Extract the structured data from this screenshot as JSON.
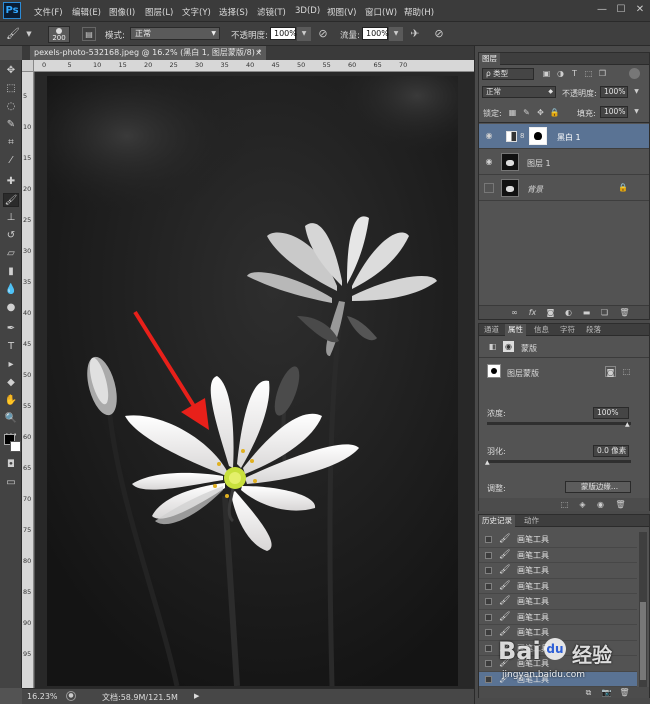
{
  "app": {
    "logo": "Ps"
  },
  "menubar": {
    "items": [
      "文件(F)",
      "编辑(E)",
      "图像(I)",
      "图层(L)",
      "文字(Y)",
      "选择(S)",
      "滤镜(T)",
      "3D(D)",
      "视图(V)",
      "窗口(W)",
      "帮助(H)"
    ],
    "window_buttons": {
      "minimize": "—",
      "maximize": "☐",
      "close": "✕"
    }
  },
  "options_bar": {
    "brush_size": "200",
    "mode_label": "模式:",
    "mode_value": "正常",
    "opacity_label": "不透明度:",
    "opacity_value": "100%",
    "flow_label": "流量:",
    "flow_value": "100%"
  },
  "document": {
    "tab_title": "pexels-photo-532168.jpeg @ 16.2% (黑白 1, 图层蒙版/8) *",
    "close": "×"
  },
  "rulers": {
    "h_ticks": [
      "0",
      "5",
      "10",
      "15",
      "20",
      "25",
      "30",
      "35",
      "40",
      "45",
      "50",
      "55",
      "60",
      "65",
      "70"
    ],
    "v_ticks": [
      "5",
      "10",
      "15",
      "20",
      "25",
      "30",
      "35",
      "40",
      "45",
      "50",
      "55",
      "60",
      "65",
      "70",
      "75",
      "80",
      "85",
      "90",
      "95"
    ]
  },
  "status": {
    "zoom": "16.23%",
    "doc_info": "文档:58.9M/121.5M"
  },
  "layers_panel": {
    "tab": "图层",
    "filter_kind": "ρ 类型",
    "blend_mode": "正常",
    "opacity_label": "不透明度:",
    "opacity_value": "100%",
    "lock_label": "锁定:",
    "fill_label": "填充:",
    "fill_value": "100%",
    "layers": [
      {
        "name": "黑白 1",
        "selected": true
      },
      {
        "name": "图层 1",
        "selected": false
      },
      {
        "name": "背景",
        "selected": false
      }
    ]
  },
  "properties_panel": {
    "tabs": [
      "通道",
      "属性",
      "信息",
      "字符",
      "段落"
    ],
    "active_tab": "属性",
    "header": "蒙版",
    "mask_type": "图层蒙版",
    "density_label": "浓度:",
    "density_value": "100%",
    "feather_label": "羽化:",
    "feather_value": "0.0 像素",
    "adjust_label": "调整:",
    "mask_edge_button": "蒙版边缘..."
  },
  "history_panel": {
    "tabs": [
      "历史记录",
      "动作"
    ],
    "active_tab": "历史记录",
    "items": [
      "画笔工具",
      "画笔工具",
      "画笔工具",
      "画笔工具",
      "画笔工具",
      "画笔工具",
      "画笔工具",
      "画笔工具",
      "画笔工具",
      "画笔工具"
    ]
  },
  "watermark": {
    "text": "Bai",
    "text2": "经验",
    "url": "jingyan.baidu.com"
  },
  "colors": {
    "accent": "#31a8ff",
    "selected_layer": "#5a7394",
    "arrow": "#e8201a",
    "flower_center": "#c8e03c"
  }
}
